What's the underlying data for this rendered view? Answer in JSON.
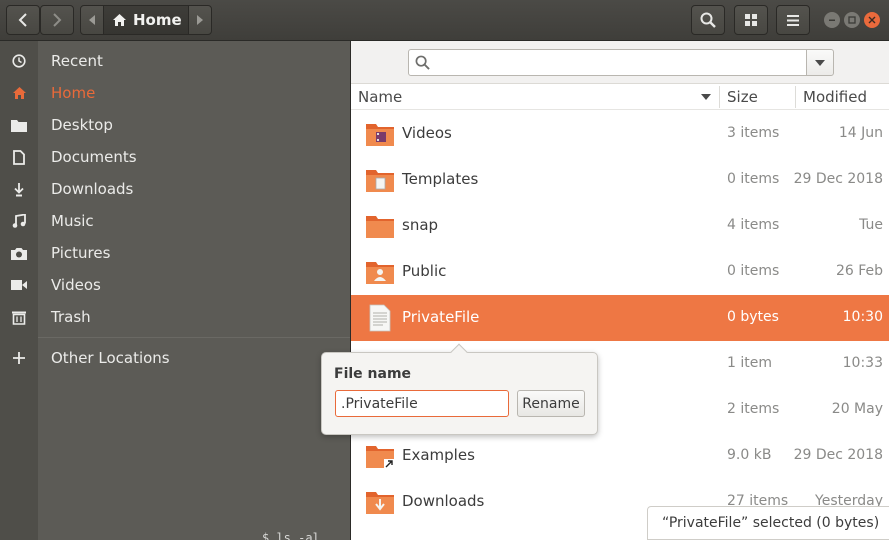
{
  "header": {
    "path_home_label": "Home",
    "accent": "#e96a3a"
  },
  "sidebar": {
    "items": [
      {
        "label": "Recent",
        "icon": "clock-icon"
      },
      {
        "label": "Home",
        "icon": "home-icon",
        "active": true
      },
      {
        "label": "Desktop",
        "icon": "folder-icon"
      },
      {
        "label": "Documents",
        "icon": "document-icon"
      },
      {
        "label": "Downloads",
        "icon": "download-icon"
      },
      {
        "label": "Music",
        "icon": "music-icon"
      },
      {
        "label": "Pictures",
        "icon": "camera-icon"
      },
      {
        "label": "Videos",
        "icon": "video-icon"
      },
      {
        "label": "Trash",
        "icon": "trash-icon"
      },
      {
        "label": "Other Locations",
        "icon": "plus-icon"
      }
    ]
  },
  "search": {
    "placeholder": ""
  },
  "columns": {
    "name": "Name",
    "size": "Size",
    "modified": "Modified"
  },
  "files": [
    {
      "name": "Videos",
      "size": "3 items",
      "modified": "14 Jun",
      "icon": "folder-videos-icon"
    },
    {
      "name": "Templates",
      "size": "0 items",
      "modified": "29 Dec 2018",
      "icon": "folder-templates-icon"
    },
    {
      "name": "snap",
      "size": "4 items",
      "modified": "Tue",
      "icon": "folder-icon"
    },
    {
      "name": "Public",
      "size": "0 items",
      "modified": "26 Feb",
      "icon": "folder-public-icon"
    },
    {
      "name": "PrivateFile",
      "size": "0 bytes",
      "modified": "10:30",
      "icon": "text-file-icon",
      "selected": true
    },
    {
      "name": "",
      "size": "1 item",
      "modified": "10:33",
      "icon": ""
    },
    {
      "name": "",
      "size": "2 items",
      "modified": "20 May",
      "icon": ""
    },
    {
      "name": "Examples",
      "size": "9.0 kB",
      "modified": "29 Dec 2018",
      "icon": "folder-link-icon"
    },
    {
      "name": "Downloads",
      "size": "27 items",
      "modified": "Yesterday",
      "icon": "folder-downloads-icon"
    }
  ],
  "rename_popover": {
    "label": "File name",
    "value": ".PrivateFile",
    "button": "Rename"
  },
  "status": "“PrivateFile” selected  (0 bytes)",
  "background_fragment": "$ ls -al"
}
